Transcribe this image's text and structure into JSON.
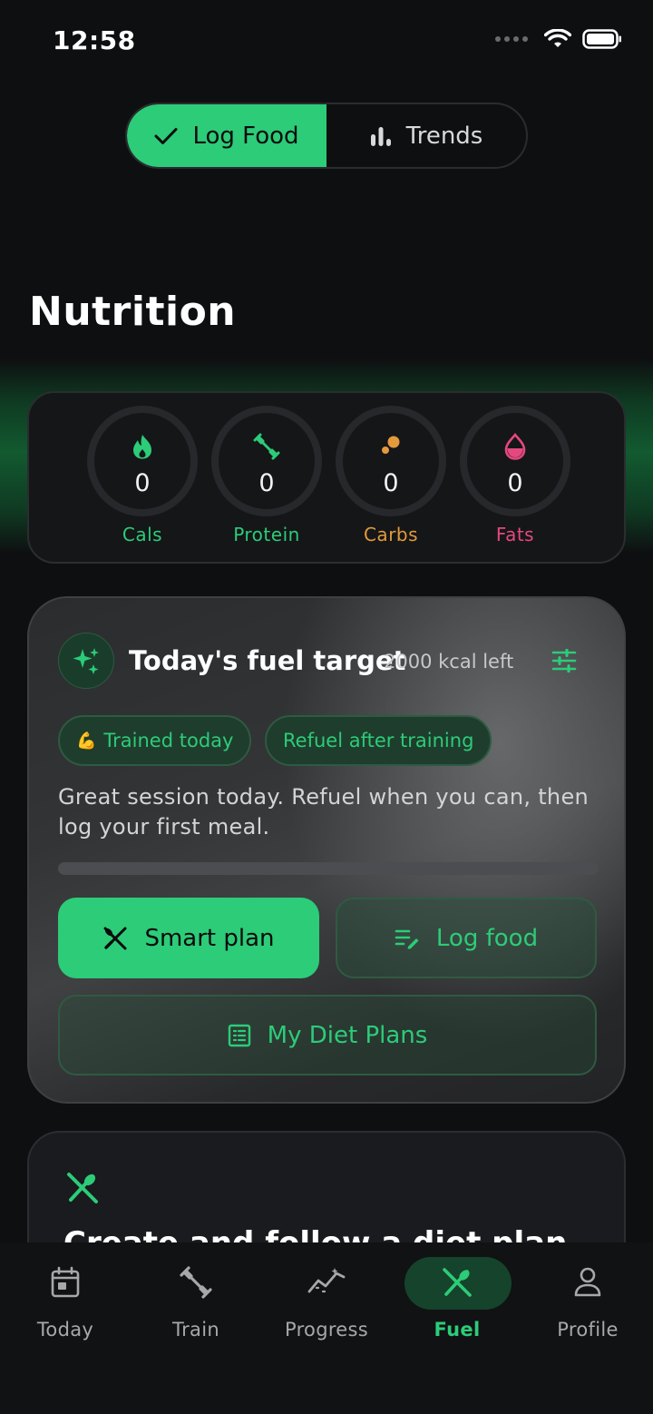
{
  "status_bar": {
    "time": "12:58"
  },
  "segmented": {
    "log_food": "Log Food",
    "trends": "Trends"
  },
  "page_title": "Nutrition",
  "macros": [
    {
      "value": "0",
      "label": "Cals",
      "color": "#2ccc78",
      "icon": "flame-icon"
    },
    {
      "value": "0",
      "label": "Protein",
      "color": "#2ccc78",
      "icon": "dumbbell-icon"
    },
    {
      "value": "0",
      "label": "Carbs",
      "color": "#e39a3c",
      "icon": "carbs-dots-icon"
    },
    {
      "value": "0",
      "label": "Fats",
      "color": "#e5487f",
      "icon": "drop-icon"
    }
  ],
  "fuel_card": {
    "title": "Today's fuel target",
    "kcal_left": "2000 kcal left",
    "chips": [
      {
        "emoji": "💪",
        "label": "Trained today"
      },
      {
        "label": "Refuel after training"
      }
    ],
    "description": "Great session today. Refuel when you can, then log your first meal.",
    "progress": 0,
    "smart_plan": "Smart plan",
    "log_food": "Log food",
    "my_diet_plans": "My Diet Plans"
  },
  "diet_card": {
    "title": "Create and follow a diet plan"
  },
  "tabs": [
    {
      "label": "Today",
      "icon": "calendar-icon"
    },
    {
      "label": "Train",
      "icon": "dumbbell-icon"
    },
    {
      "label": "Progress",
      "icon": "trend-icon"
    },
    {
      "label": "Fuel",
      "icon": "fork-spoon-icon",
      "active": true
    },
    {
      "label": "Profile",
      "icon": "person-icon"
    }
  ],
  "colors": {
    "accent": "#2ccc78",
    "background": "#0e0f11",
    "carbs": "#e39a3c",
    "fats": "#e5487f"
  }
}
